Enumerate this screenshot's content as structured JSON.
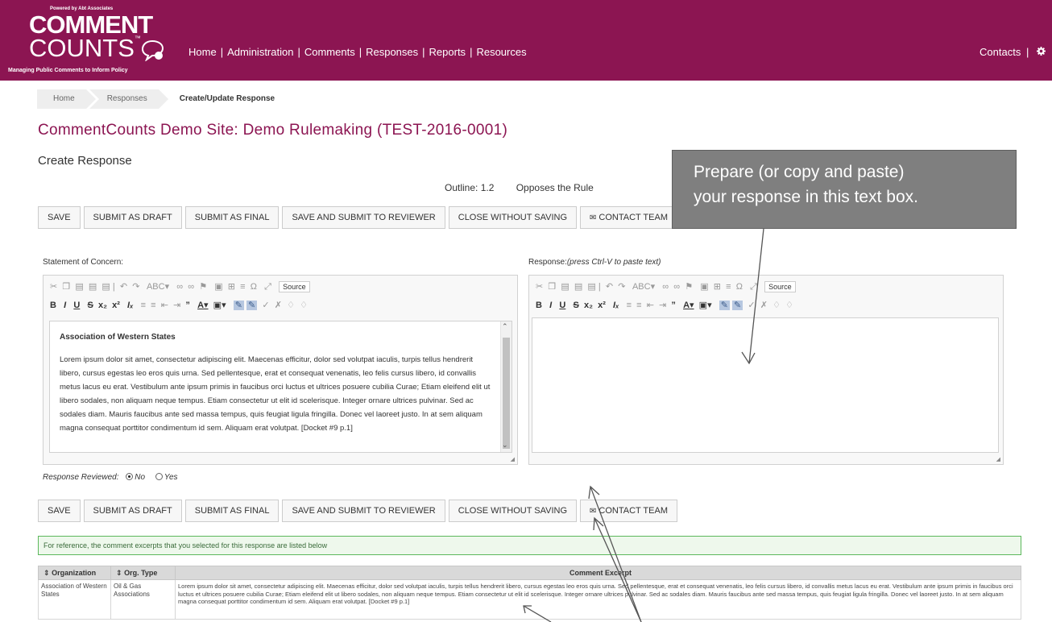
{
  "header": {
    "logo": {
      "powered_by": "Powered by Abt Associates",
      "word1": "COMMENT",
      "word2": "COUNTS",
      "tm": "™",
      "tagline": "Managing Public Comments to Inform Policy"
    },
    "nav": [
      "Home",
      "Administration",
      "Comments",
      "Responses",
      "Reports",
      "Resources"
    ],
    "nav_right": {
      "contacts": "Contacts",
      "gear_icon": "gear-icon"
    }
  },
  "breadcrumb": [
    "Home",
    "Responses",
    "Create/Update Response"
  ],
  "page_title": "CommentCounts Demo Site: Demo Rulemaking (TEST-2016-0001)",
  "sub_title": "Create Response",
  "outline": {
    "label": "Outline: 1.2",
    "position": "Opposes the Rule"
  },
  "buttons": {
    "save": "SAVE",
    "submit_draft": "SUBMIT AS DRAFT",
    "submit_final": "SUBMIT AS FINAL",
    "save_submit_reviewer": "SAVE AND SUBMIT TO REVIEWER",
    "close_without_saving": "CLOSE WITHOUT SAVING",
    "contact_team": "CONTACT TEAM"
  },
  "callout": {
    "line1": "Prepare (or copy and paste)",
    "line2": "your response in this text box."
  },
  "concern": {
    "label": "Statement of Concern:",
    "heading": "Association of Western States",
    "body": "Lorem ipsum dolor sit amet, consectetur adipiscing elit. Maecenas efficitur, dolor sed volutpat iaculis, turpis tellus hendrerit libero, cursus egestas leo eros quis urna. Sed pellentesque, erat et consequat venenatis, leo felis cursus libero, id convallis metus lacus eu erat. Vestibulum ante ipsum primis in faucibus orci luctus et ultrices posuere cubilia Curae; Etiam eleifend elit ut libero sodales, non aliquam neque tempus. Etiam consectetur ut elit id scelerisque. Integer ornare ultrices pulvinar. Sed ac sodales diam. Mauris faucibus ante sed massa tempus, quis feugiat ligula fringilla. Donec vel laoreet justo. In at sem aliquam magna consequat porttitor condimentum id sem. Aliquam erat volutpat. [Docket #9 p.1]"
  },
  "response": {
    "label": "Response:",
    "hint": "(press Ctrl-V to paste text)",
    "value": ""
  },
  "toolbar": {
    "source": "Source"
  },
  "reviewed": {
    "label": "Response Reviewed:",
    "no": "No",
    "yes": "Yes",
    "selected": "No"
  },
  "reference_note": "For reference, the comment excerpts that you selected for this response are listed below",
  "table": {
    "headers": [
      "Organization",
      "Org. Type",
      "Comment Excerpt"
    ],
    "rows": [
      {
        "organization": "Association of Western States",
        "org_type": "Oil & Gas Associations",
        "excerpt": "Lorem ipsum dolor sit amet, consectetur adipiscing elit. Maecenas efficitur, dolor sed volutpat iaculis, turpis tellus hendrerit libero, cursus egestas leo eros quis urna. Sed pellentesque, erat et consequat venenatis, leo felis cursus libero, id convallis metus lacus eu erat. Vestibulum ante ipsum primis in faucibus orci luctus et ultrices posuere cubilia Curae; Etiam eleifend elit ut libero sodales, non aliquam neque tempus. Etiam consectetur ut elit id scelerisque. Integer ornare ultrices pulvinar. Sed ac sodales diam. Mauris faucibus ante sed massa tempus, quis feugiat ligula fringilla. Donec vel laoreet justo. In at sem aliquam magna consequat porttitor condimentum id sem. Aliquam erat volutpat. [Docket #9 p.1]"
      }
    ]
  },
  "colors": {
    "brand": "#8c1552",
    "callout": "#7f7f7f",
    "ref_border": "#5cb85c"
  }
}
